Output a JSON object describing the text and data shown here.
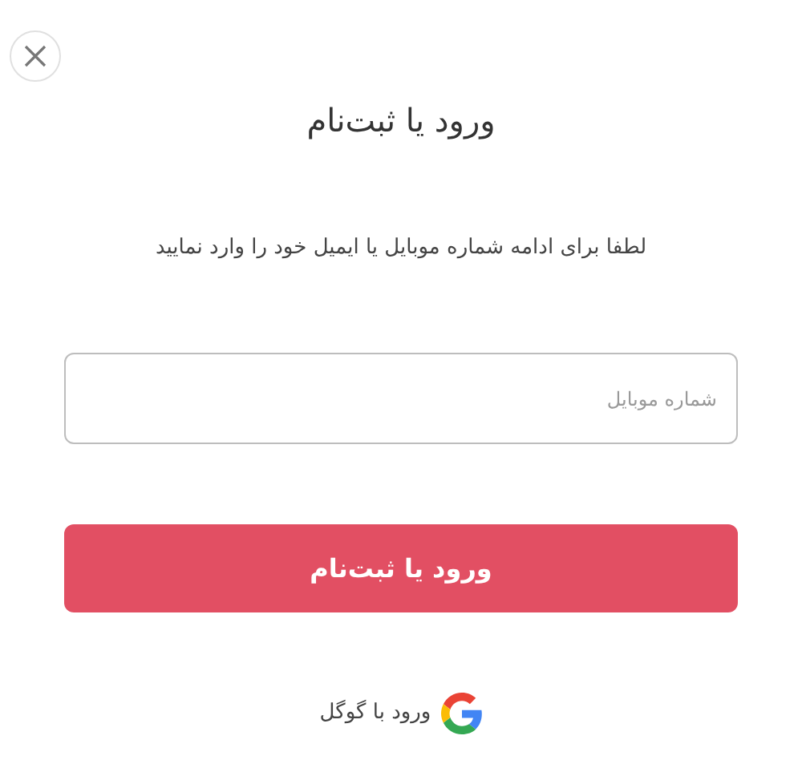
{
  "title": "ورود یا ثبت‌نام",
  "instruction": "لطفا برای ادامه شماره موبایل یا ایمیل خود را وارد نمایید",
  "mobile_field": {
    "placeholder": "شماره موبایل"
  },
  "submit_button": {
    "label": "ورود یا ثبت‌نام"
  },
  "google_login": {
    "label": "ورود با گوگل"
  }
}
